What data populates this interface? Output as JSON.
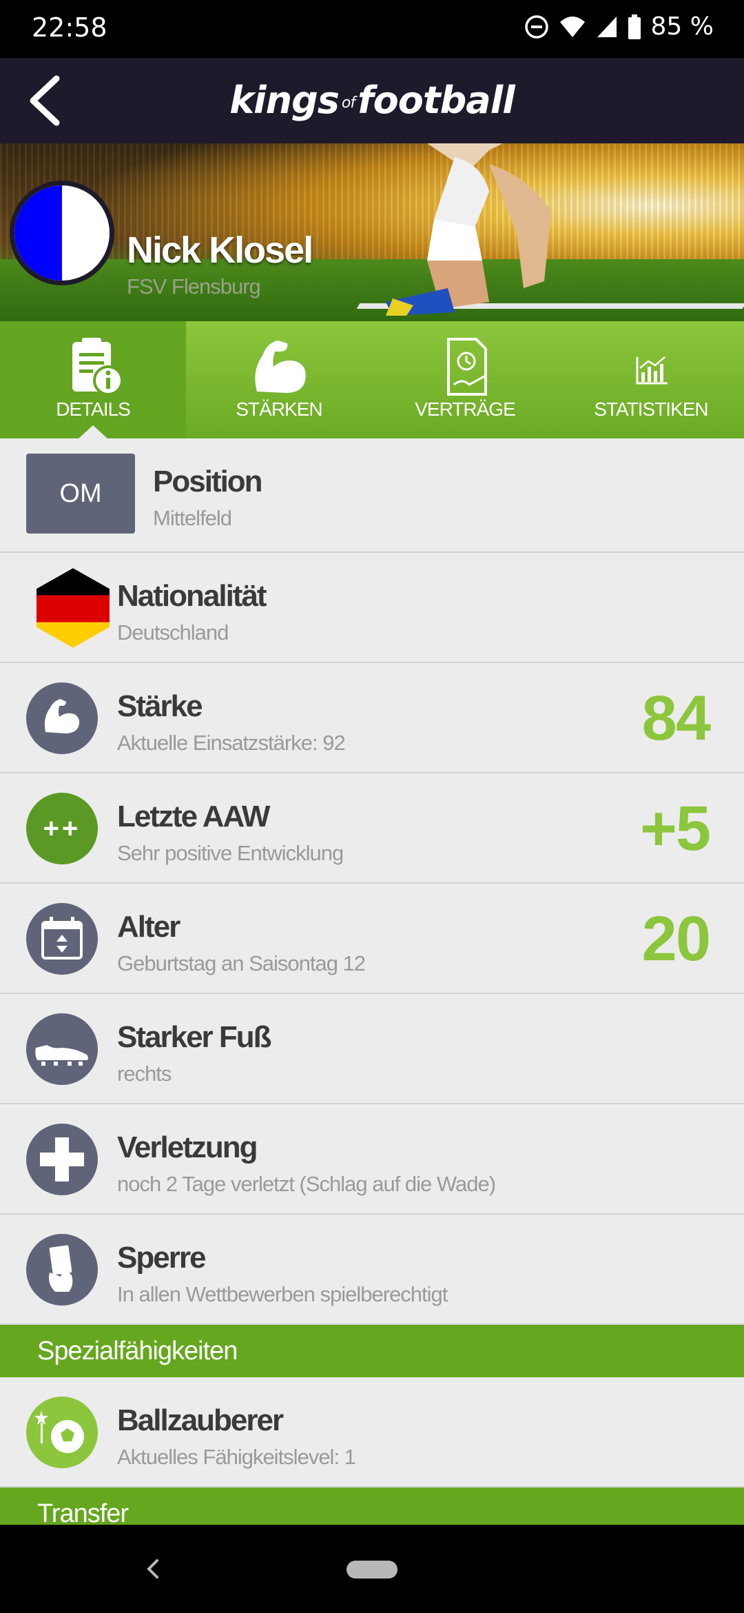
{
  "status": {
    "time": "22:58",
    "battery": "85 %"
  },
  "appbar": {
    "logo_left": "kings",
    "logo_of": "of",
    "logo_right": "football"
  },
  "player": {
    "name": "Nick Klosel",
    "club": "FSV Flensburg"
  },
  "tabs": [
    {
      "label": "DETAILS",
      "icon": "document-info-icon",
      "active": true
    },
    {
      "label": "STÄRKEN",
      "icon": "flexed-arm-icon",
      "active": false
    },
    {
      "label": "VERTRÄGE",
      "icon": "contract-icon",
      "active": false
    },
    {
      "label": "STATISTIKEN",
      "icon": "bar-chart-icon",
      "active": false
    }
  ],
  "details": {
    "position": {
      "badge": "OM",
      "title": "Position",
      "sub": "Mittelfeld"
    },
    "nationality": {
      "title": "Nationalität",
      "sub": "Deutschland"
    },
    "strength": {
      "title": "Stärke",
      "sub": "Aktuelle Einsatzstärke: 92",
      "value": "84"
    },
    "aaw": {
      "title": "Letzte AAW",
      "sub": "Sehr positive Entwicklung",
      "value": "+5",
      "badge": "++"
    },
    "age": {
      "title": "Alter",
      "sub": "Geburtstag an Saisontag 12",
      "value": "20"
    },
    "foot": {
      "title": "Starker Fuß",
      "sub": "rechts"
    },
    "injury": {
      "title": "Verletzung",
      "sub": "noch 2 Tage verletzt (Schlag auf die Wade)"
    },
    "ban": {
      "title": "Sperre",
      "sub": "In allen Wettbewerben spielberechtigt"
    }
  },
  "sections": {
    "special": "Spezialfähigkeiten",
    "transfer": "Transfer"
  },
  "special_abilities": [
    {
      "title": "Ballzauberer",
      "sub": "Aktuelles Fähigkeitslevel: 1"
    }
  ],
  "colors": {
    "accent_green": "#8cc63c",
    "section_green": "#65a71f",
    "appbar": "#1e1a2b",
    "icon_grey": "#5f6478"
  }
}
